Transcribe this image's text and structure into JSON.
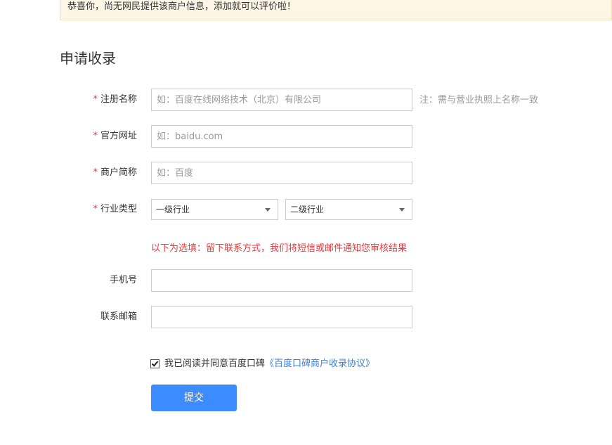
{
  "notice": {
    "text": "恭喜你，尚无网民提供该商户信息，添加就可以评价啦！"
  },
  "page_title": "申请收录",
  "required_mark": "*",
  "form": {
    "registered_name": {
      "label": "注册名称",
      "value": "",
      "placeholder": "如：百度在线网络技术（北京）有限公司",
      "hint": "注：需与营业执照上名称一致"
    },
    "website": {
      "label": "官方网址",
      "value": "",
      "placeholder": "如：baidu.com"
    },
    "short_name": {
      "label": "商户简称",
      "value": "",
      "placeholder": "如：百度"
    },
    "industry": {
      "label": "行业类型",
      "level1": "一级行业",
      "level2": "二级行业"
    },
    "optional_note": "以下为选填：留下联系方式，我们将短信或邮件通知您审核结果",
    "phone": {
      "label": "手机号",
      "value": "",
      "placeholder": ""
    },
    "email": {
      "label": "联系邮箱",
      "value": "",
      "placeholder": ""
    },
    "agreement": {
      "checked": true,
      "text": "我已阅读并同意百度口碑",
      "link": "《百度口碑商户收录协议》"
    },
    "submit_label": "提交"
  },
  "colors": {
    "accent": "#3c8cff",
    "required": "#e4393c",
    "link": "#3b7fd8",
    "notice_bg": "#fdf5e6"
  }
}
